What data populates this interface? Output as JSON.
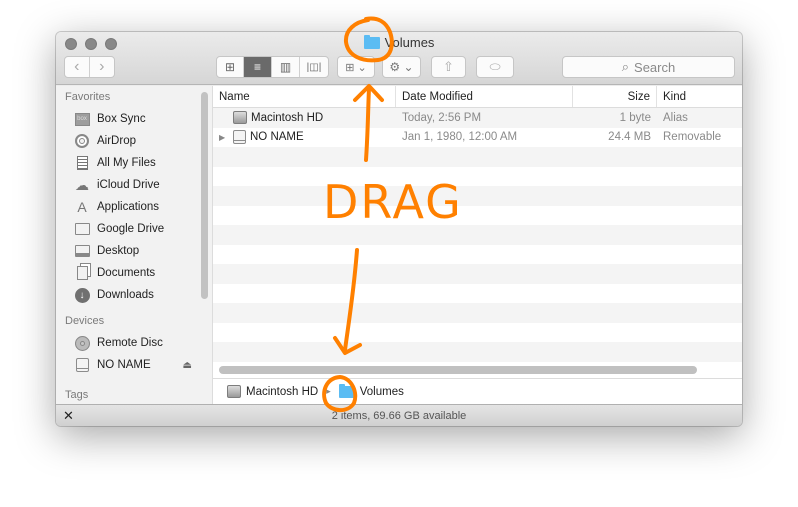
{
  "window": {
    "title": "Volumes",
    "title_icon": "folder-icon"
  },
  "toolbar": {
    "back_icon": "‹",
    "forward_icon": "›",
    "view_icons": "⊞",
    "view_list": "≡",
    "view_columns": "▥",
    "view_coverflow": "|◫|",
    "group_glyph": "⊞ ⌄",
    "action_glyph": "⚙ ⌄",
    "share_glyph": "⇧",
    "tag_glyph": "⬭",
    "search_placeholder": "Search"
  },
  "sidebar": {
    "sections": [
      {
        "title": "Favorites",
        "items": [
          {
            "label": "Box Sync",
            "icon": "box-icon"
          },
          {
            "label": "AirDrop",
            "icon": "airdrop-icon"
          },
          {
            "label": "All My Files",
            "icon": "all-files-icon"
          },
          {
            "label": "iCloud Drive",
            "icon": "cloud-icon"
          },
          {
            "label": "Applications",
            "icon": "applications-icon"
          },
          {
            "label": "Google Drive",
            "icon": "folder-icon"
          },
          {
            "label": "Desktop",
            "icon": "desktop-icon"
          },
          {
            "label": "Documents",
            "icon": "documents-icon"
          },
          {
            "label": "Downloads",
            "icon": "downloads-icon"
          }
        ]
      },
      {
        "title": "Devices",
        "items": [
          {
            "label": "Remote Disc",
            "icon": "disc-icon"
          },
          {
            "label": "NO NAME",
            "icon": "drive-icon",
            "eject": "⏏"
          }
        ]
      },
      {
        "title": "Tags",
        "items": []
      }
    ]
  },
  "list": {
    "columns": [
      "Name",
      "Date Modified",
      "Size",
      "Kind"
    ],
    "rows": [
      {
        "name": "Macintosh HD",
        "date": "Today, 2:56 PM",
        "size": "1 byte",
        "kind": "Alias",
        "icon": "hard-drive-alias-icon",
        "expandable": false
      },
      {
        "name": "NO NAME",
        "date": "Jan 1, 1980, 12:00 AM",
        "size": "24.4 MB",
        "kind": "Removable",
        "icon": "drive-icon",
        "expandable": true
      }
    ]
  },
  "pathbar": {
    "items": [
      {
        "label": "Macintosh HD",
        "icon": "hard-drive-icon"
      },
      {
        "label": "Volumes",
        "icon": "folder-icon"
      }
    ],
    "separator": "▸"
  },
  "status": {
    "text": "2 items, 69.66 GB available",
    "toggle_glyph": "✕"
  },
  "annotation": {
    "label": "DRAG",
    "color": "#ff8000"
  }
}
